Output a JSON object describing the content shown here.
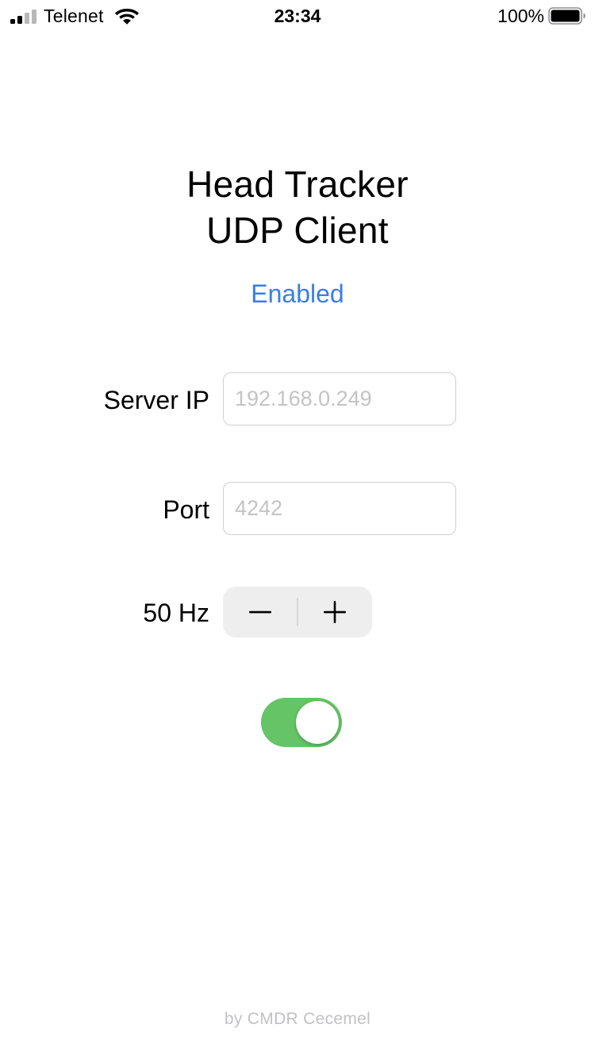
{
  "status_bar": {
    "carrier": "Telenet",
    "time": "23:34",
    "battery_percent": "100%",
    "signal_bars_active": 2,
    "signal_bars_total": 4,
    "battery_level": 1.0,
    "icons": [
      "signal-icon",
      "wifi-icon",
      "battery-icon"
    ]
  },
  "app": {
    "title_line1": "Head Tracker",
    "title_line2": "UDP Client",
    "status": "Enabled"
  },
  "form": {
    "server_ip": {
      "label": "Server IP",
      "value": "",
      "placeholder": "192.168.0.249"
    },
    "port": {
      "label": "Port",
      "value": "",
      "placeholder": "4242"
    },
    "rate": {
      "label": "50 Hz",
      "decrement_icon": "minus-icon",
      "increment_icon": "plus-icon"
    },
    "enabled_toggle": {
      "on": true
    }
  },
  "footer": {
    "credit": "by CMDR Cecemel"
  },
  "colors": {
    "accent": "#3a7ee6",
    "toggle_on": "#65c466",
    "signal_active": "#000000",
    "signal_inactive": "#b8b8b8",
    "text": "#000000",
    "placeholder": "#c4c4c6",
    "footer": "#c2c2c4"
  }
}
